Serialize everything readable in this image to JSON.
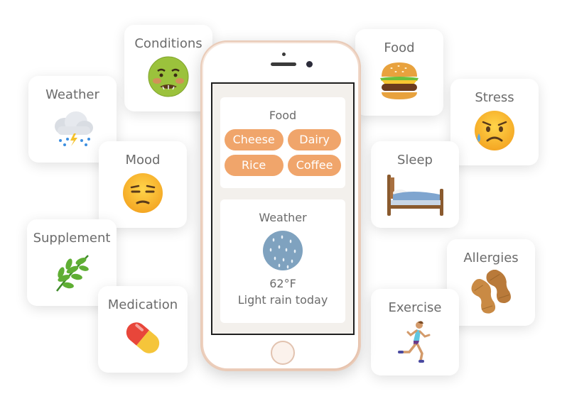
{
  "cards": {
    "conditions": "Conditions",
    "weather": "Weather",
    "mood": "Mood",
    "supplement": "Supplement",
    "medication": "Medication",
    "food": "Food",
    "stress": "Stress",
    "sleep": "Sleep",
    "allergies": "Allergies",
    "exercise": "Exercise"
  },
  "icons": {
    "conditions": "nauseated-face-icon",
    "weather": "storm-cloud-icon",
    "mood": "unamused-face-icon",
    "supplement": "herb-icon",
    "medication": "pill-icon",
    "food": "hamburger-icon",
    "stress": "anxious-face-icon",
    "sleep": "bed-icon",
    "allergies": "peanut-icon",
    "exercise": "runner-icon"
  },
  "phone": {
    "food_panel": {
      "title": "Food",
      "tags": [
        "Cheese",
        "Dairy",
        "Rice",
        "Coffee"
      ]
    },
    "weather_panel": {
      "title": "Weather",
      "temperature": "62°F",
      "description": "Light rain today"
    }
  },
  "colors": {
    "tag": "#f0a56b",
    "phone_frame": "#efd3c2",
    "screen_bg": "#f3f0ec",
    "text": "#6b6b6b"
  }
}
